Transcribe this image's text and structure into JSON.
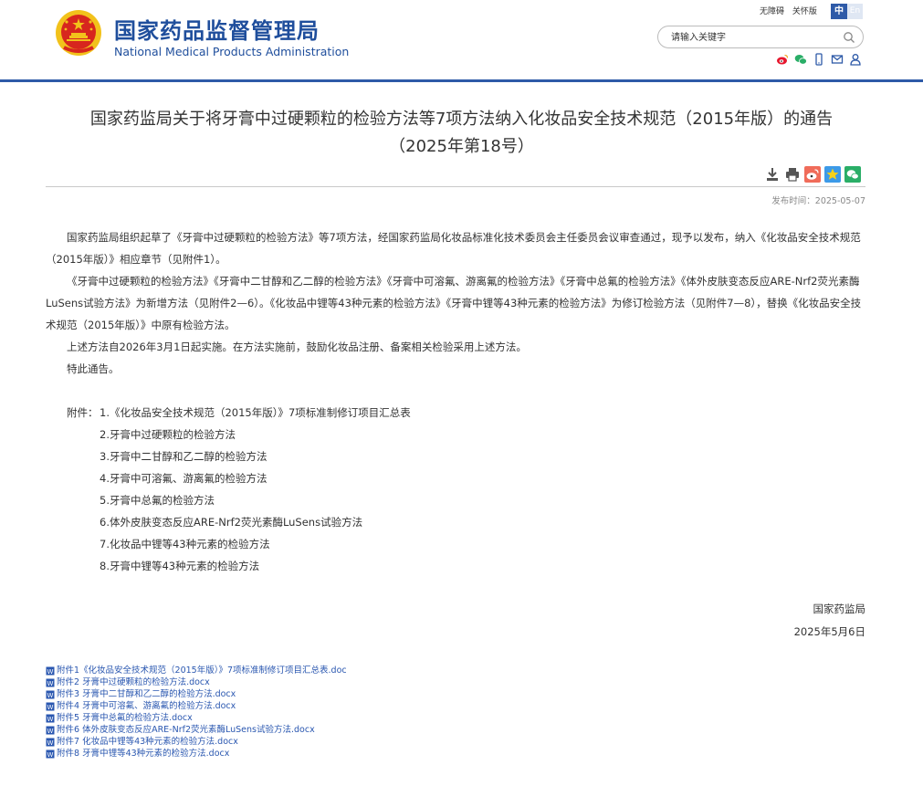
{
  "header": {
    "site_name_cn": "国家药品监督管理局",
    "site_name_en": "National Medical Products Administration",
    "toplinks": [
      "无障碍",
      "关怀版"
    ],
    "lang_zh": "中",
    "lang_en": "En",
    "search_placeholder": "请输入关键字",
    "social_icons": [
      "weibo-icon",
      "wechat-icon",
      "mobile-icon",
      "mail-icon",
      "user-icon"
    ]
  },
  "article": {
    "title_line1": "国家药监局关于将牙膏中过硬颗粒的检验方法等7项方法纳入化妆品安全技术规范（2015年版）的通告",
    "title_line2": "（2025年第18号）",
    "pubdate": "发布时间：2025-05-07",
    "paragraphs": [
      "国家药监局组织起草了《牙膏中过硬颗粒的检验方法》等7项方法，经国家药监局化妆品标准化技术委员会主任委员会议审查通过，现予以发布，纳入《化妆品安全技术规范（2015年版）》相应章节（见附件1）。",
      "《牙膏中过硬颗粒的检验方法》《牙膏中二甘醇和乙二醇的检验方法》《牙膏中可溶氟、游离氟的检验方法》《牙膏中总氟的检验方法》《体外皮肤变态反应ARE-Nrf2荧光素酶LuSens试验方法》为新增方法（见附件2—6）。《化妆品中锂等43种元素的检验方法》《牙膏中锂等43种元素的检验方法》为修订检验方法（见附件7—8），替换《化妆品安全技术规范（2015年版）》中原有检验方法。",
      "上述方法自2026年3月1日起实施。在方法实施前，鼓励化妆品注册、备案相关检验采用上述方法。",
      "特此通告。"
    ],
    "annex_lead": "附件：",
    "annex_items": [
      "1.《化妆品安全技术规范（2015年版）》7项标准制修订项目汇总表",
      "2.牙膏中过硬颗粒的检验方法",
      "3.牙膏中二甘醇和乙二醇的检验方法",
      "4.牙膏中可溶氟、游离氟的检验方法",
      "5.牙膏中总氟的检验方法",
      "6.体外皮肤变态反应ARE-Nrf2荧光素酶LuSens试验方法",
      "7.化妆品中锂等43种元素的检验方法",
      "8.牙膏中锂等43种元素的检验方法"
    ],
    "signature_org": "国家药监局",
    "signature_date": "2025年5月6日",
    "attachments": [
      "附件1《化妆品安全技术规范（2015年版）》7项标准制修订项目汇总表.doc",
      "附件2 牙膏中过硬颗粒的检验方法.docx",
      "附件3 牙膏中二甘醇和乙二醇的检验方法.docx",
      "附件4 牙膏中可溶氟、游离氟的检验方法.docx",
      "附件5 牙膏中总氟的检验方法.docx",
      "附件6 体外皮肤变态反应ARE-Nrf2荧光素酶LuSens试验方法.docx",
      "附件7 化妆品中锂等43种元素的检验方法.docx",
      "附件8 牙膏中锂等43种元素的检验方法.docx"
    ]
  },
  "colors": {
    "brand_blue": "#1f4e9c",
    "link_blue": "#2a57b0",
    "emblem_red": "#d7261e",
    "emblem_gold": "#f2c21b"
  }
}
